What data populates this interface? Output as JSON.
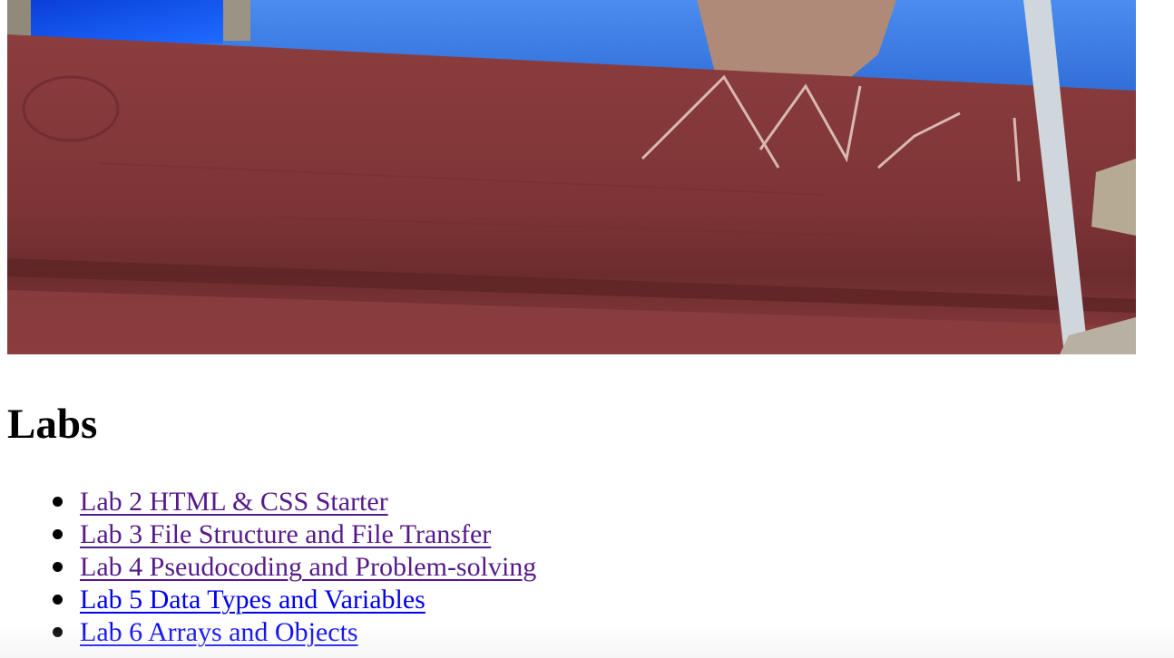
{
  "hero_image": {
    "description_icon": "photo-image",
    "colors": {
      "wood": "#8a3b3b",
      "wood_dark": "#6f2d2f",
      "denim": "#3f7fe0",
      "carving": "#e6c9c0"
    }
  },
  "section": {
    "title": "Labs"
  },
  "labs": [
    {
      "label": "Lab 2 HTML & CSS Starter",
      "visited": true
    },
    {
      "label": "Lab 3 File Structure and File Transfer",
      "visited": true
    },
    {
      "label": "Lab 4 Pseudocoding and Problem-solving",
      "visited": true
    },
    {
      "label": "Lab 5 Data Types and Variables",
      "visited": false
    },
    {
      "label": "Lab 6 Arrays and Objects",
      "visited": false
    }
  ],
  "colors": {
    "link_visited": "#551a8b",
    "link_unvisited": "#0000ee"
  }
}
